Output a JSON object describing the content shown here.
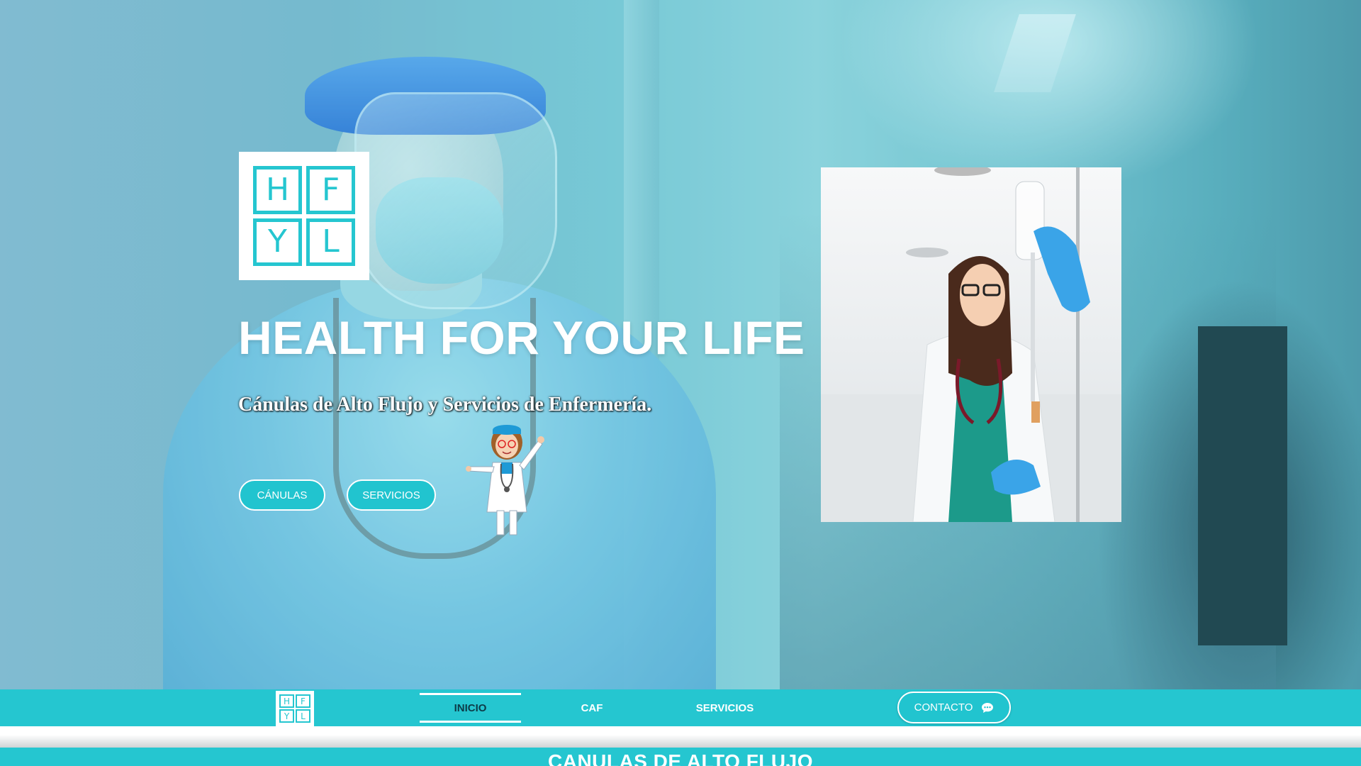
{
  "hero": {
    "logo_letters": [
      "H",
      "F",
      "Y",
      "L"
    ],
    "title": "HEALTH FOR YOUR LIFE",
    "subtitle": "Cánulas de Alto Flujo y Servicios de Enfermería.",
    "buttons": {
      "canulas": "CÁNULAS",
      "servicios": "SERVICIOS"
    }
  },
  "navbar": {
    "logo_letters": [
      "H",
      "F",
      "Y",
      "L"
    ],
    "items": [
      {
        "label": "INICIO",
        "active": true
      },
      {
        "label": "CAF",
        "active": false
      },
      {
        "label": "SERVICIOS",
        "active": false
      }
    ],
    "contact_label": "CONTACTO",
    "contact_icon": "chat-bubble-icon"
  },
  "section": {
    "title": "CANULAS DE ALTO FLUJO"
  },
  "colors": {
    "brand_teal": "#25c6d0",
    "white": "#ffffff",
    "active_nav_text": "#0d3b48"
  }
}
